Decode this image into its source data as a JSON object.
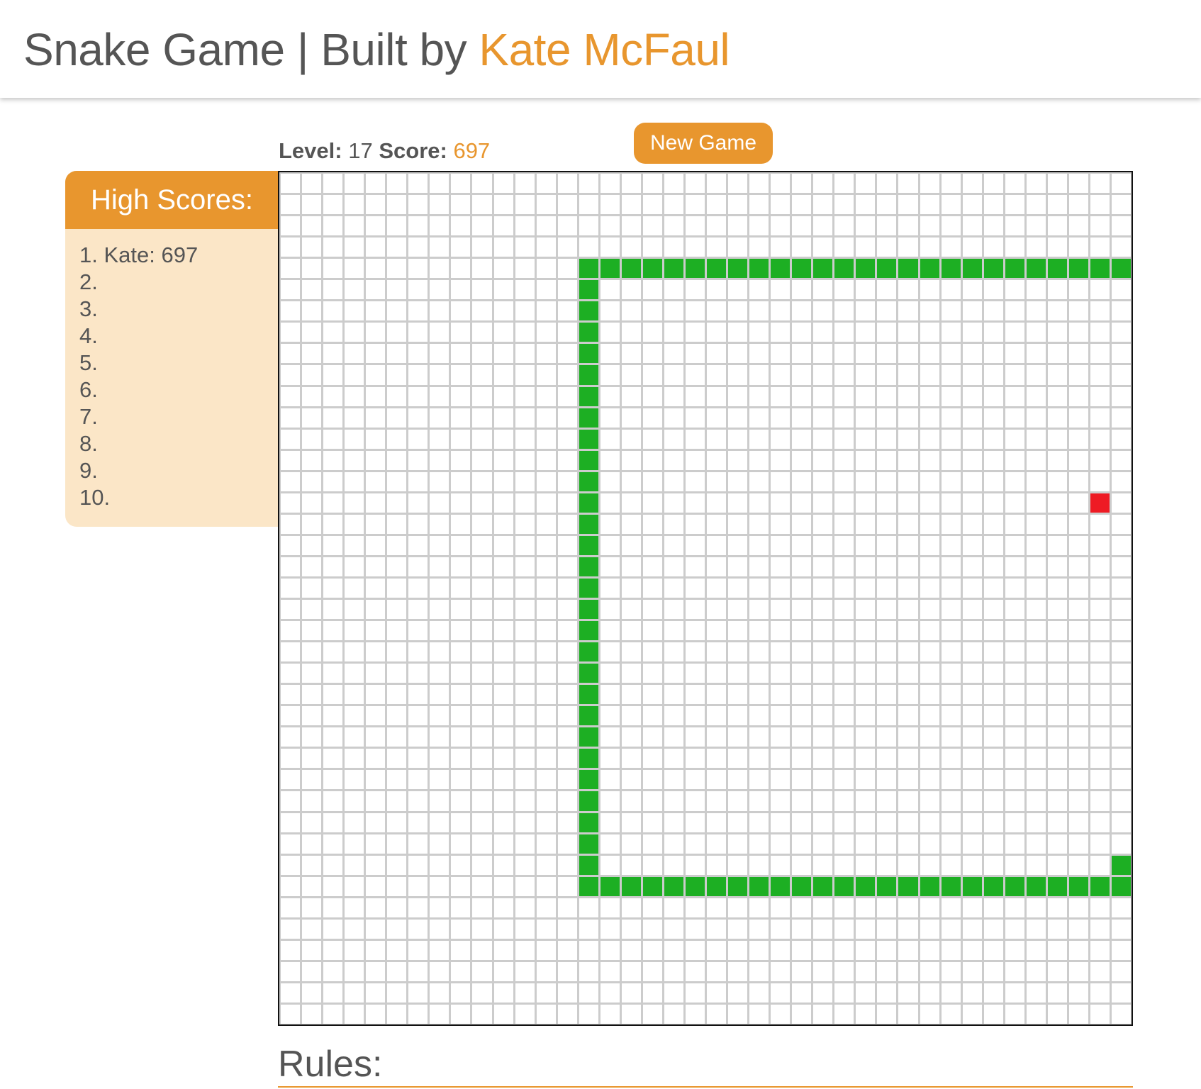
{
  "header": {
    "title_prefix": "Snake Game | Built by ",
    "author": "Kate McFaul"
  },
  "status": {
    "level_label": "Level:",
    "level_value": "17",
    "score_label": "Score:",
    "score_value": "697"
  },
  "new_game_label": "New Game",
  "high_scores": {
    "title": "High Scores:",
    "entries": [
      "1. Kate: 697",
      "2.",
      "3.",
      "4.",
      "5.",
      "6.",
      "7.",
      "8.",
      "9.",
      "10."
    ]
  },
  "game": {
    "grid_cols": 40,
    "grid_rows": 40,
    "colors": {
      "snake": "#1daf23",
      "food": "#ee1b24",
      "grid_line": "#cccccc",
      "accent": "#e8962e",
      "panel_bg": "#fbe6c7"
    },
    "snake_segments": [
      [
        14,
        4
      ],
      [
        15,
        4
      ],
      [
        16,
        4
      ],
      [
        17,
        4
      ],
      [
        18,
        4
      ],
      [
        19,
        4
      ],
      [
        20,
        4
      ],
      [
        21,
        4
      ],
      [
        22,
        4
      ],
      [
        23,
        4
      ],
      [
        24,
        4
      ],
      [
        25,
        4
      ],
      [
        26,
        4
      ],
      [
        27,
        4
      ],
      [
        28,
        4
      ],
      [
        29,
        4
      ],
      [
        30,
        4
      ],
      [
        31,
        4
      ],
      [
        32,
        4
      ],
      [
        33,
        4
      ],
      [
        34,
        4
      ],
      [
        35,
        4
      ],
      [
        36,
        4
      ],
      [
        37,
        4
      ],
      [
        38,
        4
      ],
      [
        39,
        4
      ],
      [
        14,
        5
      ],
      [
        14,
        6
      ],
      [
        14,
        7
      ],
      [
        14,
        8
      ],
      [
        14,
        9
      ],
      [
        14,
        10
      ],
      [
        14,
        11
      ],
      [
        14,
        12
      ],
      [
        14,
        13
      ],
      [
        14,
        14
      ],
      [
        14,
        15
      ],
      [
        14,
        16
      ],
      [
        14,
        17
      ],
      [
        14,
        18
      ],
      [
        14,
        19
      ],
      [
        14,
        20
      ],
      [
        14,
        21
      ],
      [
        14,
        22
      ],
      [
        14,
        23
      ],
      [
        14,
        24
      ],
      [
        14,
        25
      ],
      [
        14,
        26
      ],
      [
        14,
        27
      ],
      [
        14,
        28
      ],
      [
        14,
        29
      ],
      [
        14,
        30
      ],
      [
        14,
        31
      ],
      [
        14,
        32
      ],
      [
        14,
        33
      ],
      [
        15,
        33
      ],
      [
        16,
        33
      ],
      [
        17,
        33
      ],
      [
        18,
        33
      ],
      [
        19,
        33
      ],
      [
        20,
        33
      ],
      [
        21,
        33
      ],
      [
        22,
        33
      ],
      [
        23,
        33
      ],
      [
        24,
        33
      ],
      [
        25,
        33
      ],
      [
        26,
        33
      ],
      [
        27,
        33
      ],
      [
        28,
        33
      ],
      [
        29,
        33
      ],
      [
        30,
        33
      ],
      [
        31,
        33
      ],
      [
        32,
        33
      ],
      [
        33,
        33
      ],
      [
        34,
        33
      ],
      [
        35,
        33
      ],
      [
        36,
        33
      ],
      [
        37,
        33
      ],
      [
        38,
        33
      ],
      [
        39,
        33
      ],
      [
        39,
        32
      ]
    ],
    "food": [
      38,
      15
    ]
  },
  "rules_title": "Rules:"
}
